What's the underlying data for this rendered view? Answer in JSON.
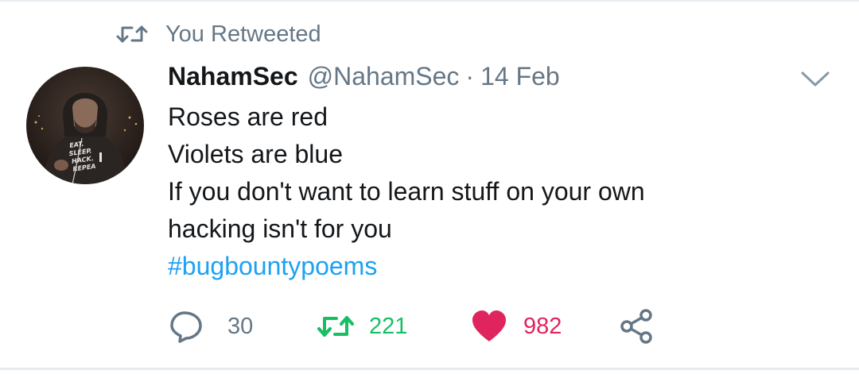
{
  "context": {
    "label": "You Retweeted",
    "icon": "retweet-icon"
  },
  "tweet": {
    "author_name": "NahamSec",
    "author_handle": "@NahamSec",
    "separator": "·",
    "date": "14 Feb",
    "lines": [
      "Roses are red",
      "Violets are blue",
      "If you don't want to learn stuff on your own",
      "hacking isn't for you"
    ],
    "hashtag": "#bugbountypoems",
    "avatar_shirt_text": [
      "EAT.",
      "SLEEP.",
      "HACK.",
      "REPEA"
    ]
  },
  "actions": {
    "reply_count": "30",
    "retweet_count": "221",
    "like_count": "982",
    "icons": [
      "reply-icon",
      "retweet-icon",
      "heart-icon",
      "share-icon"
    ]
  },
  "colors": {
    "text": "#14171a",
    "muted": "#657786",
    "link": "#1da1f2",
    "retweet_green": "#17bf63",
    "like_red": "#e0245e",
    "divider": "#e6ecf0"
  }
}
